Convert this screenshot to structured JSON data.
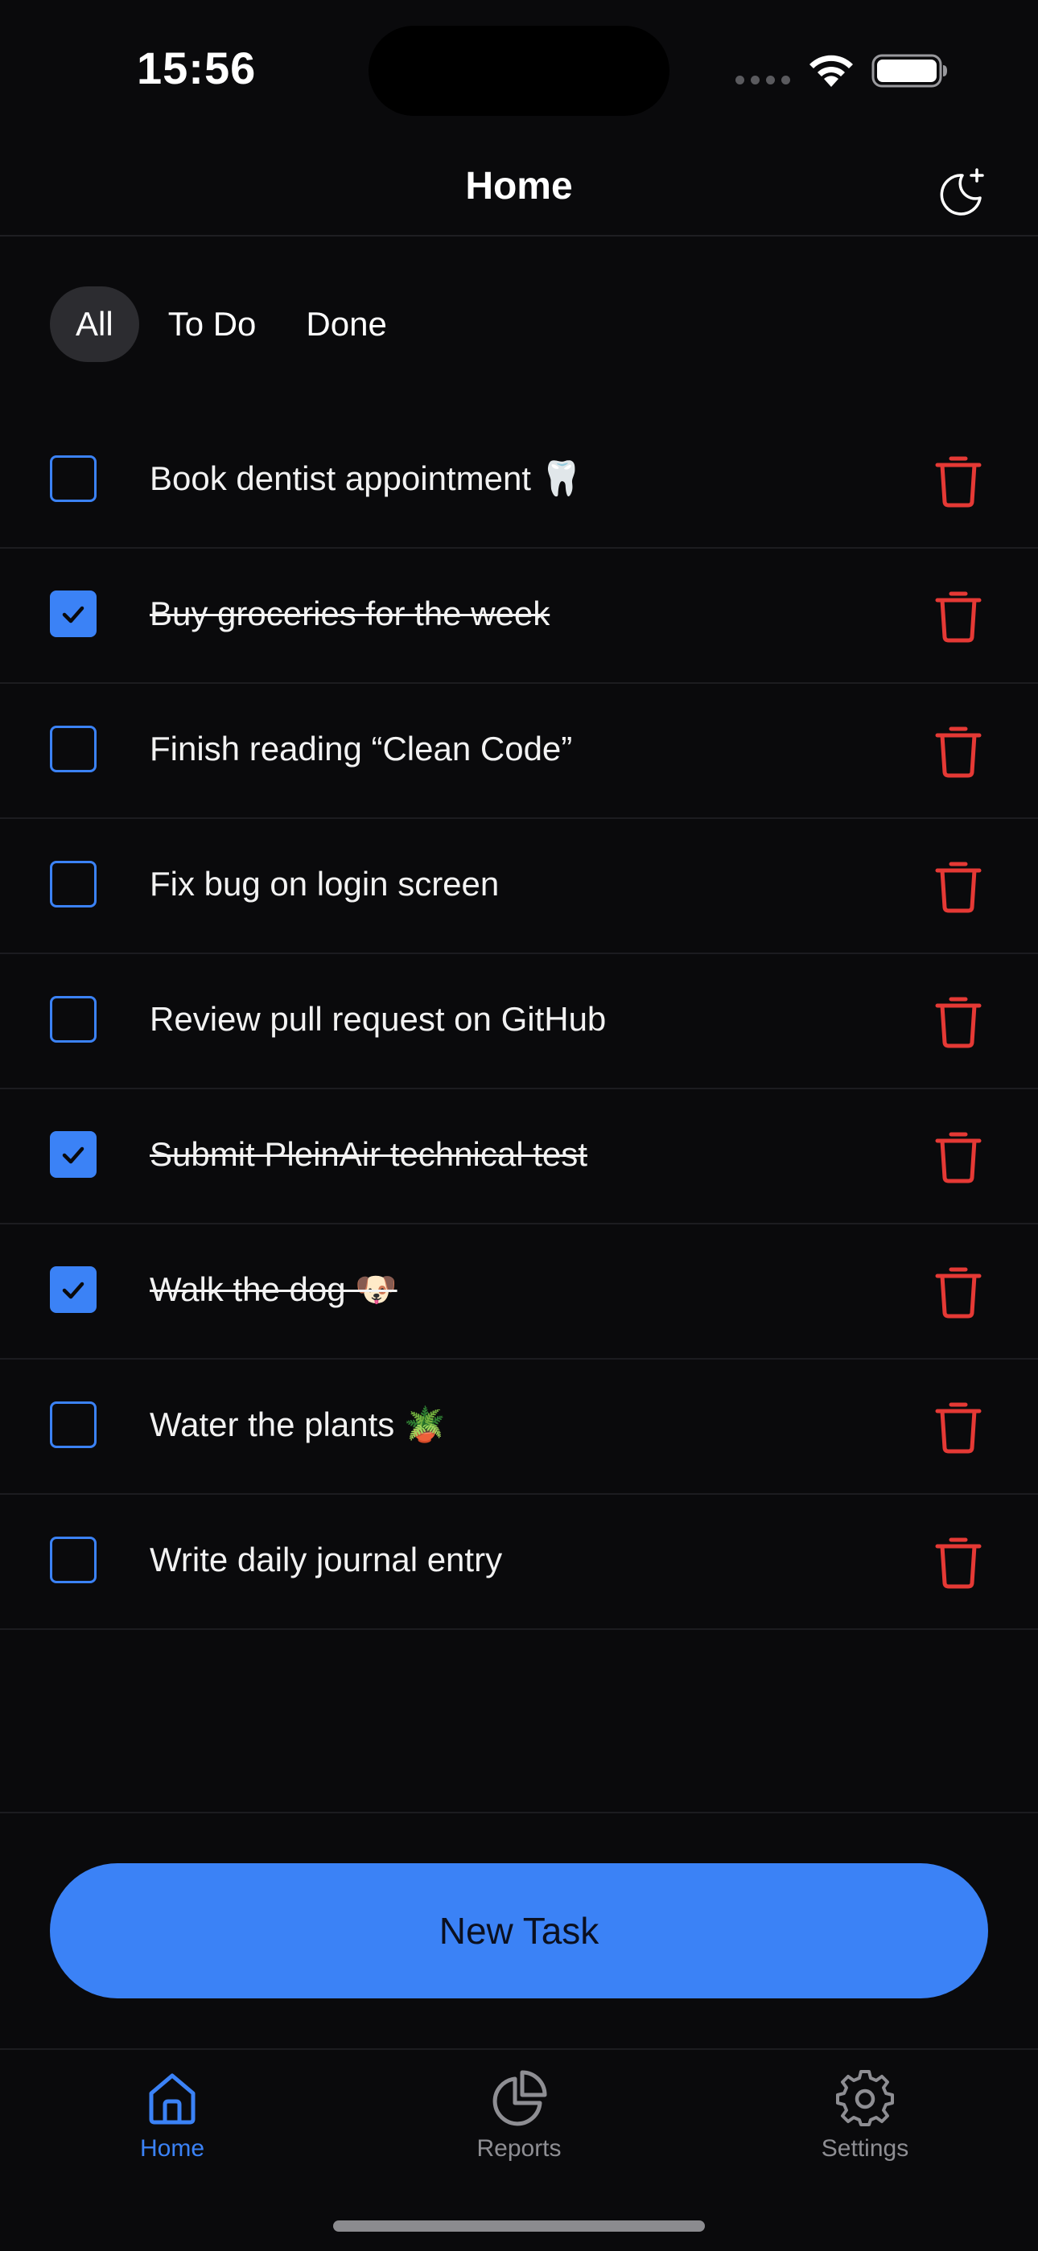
{
  "status_bar": {
    "time": "15:56",
    "icons": [
      "signal-dots-icon",
      "wifi-icon",
      "battery-icon"
    ]
  },
  "header": {
    "title": "Home",
    "theme_toggle_icon": "moon-plus-icon"
  },
  "filters": [
    {
      "label": "All",
      "active": true
    },
    {
      "label": "To Do",
      "active": false
    },
    {
      "label": "Done",
      "active": false
    }
  ],
  "tasks": [
    {
      "text": "Book dentist appointment 🦷",
      "done": false
    },
    {
      "text": "Buy groceries for the week",
      "done": true
    },
    {
      "text": "Finish reading “Clean Code”",
      "done": false
    },
    {
      "text": "Fix bug on login screen",
      "done": false
    },
    {
      "text": "Review pull request on GitHub",
      "done": false
    },
    {
      "text": "Submit PleinAir technical test",
      "done": true
    },
    {
      "text": "Walk the dog 🐶",
      "done": true
    },
    {
      "text": "Water the plants 🪴",
      "done": false
    },
    {
      "text": "Write daily journal entry",
      "done": false
    }
  ],
  "new_task_button": {
    "label": "New Task"
  },
  "tab_bar": {
    "tabs": [
      {
        "label": "Home",
        "icon": "home-icon",
        "active": true
      },
      {
        "label": "Reports",
        "icon": "pie-chart-icon",
        "active": false
      },
      {
        "label": "Settings",
        "icon": "gear-icon",
        "active": false
      }
    ]
  },
  "colors": {
    "background": "#0a0a0c",
    "accent": "#3b82f6",
    "danger": "#e53935",
    "inactive_tab": "#8e8e93"
  }
}
